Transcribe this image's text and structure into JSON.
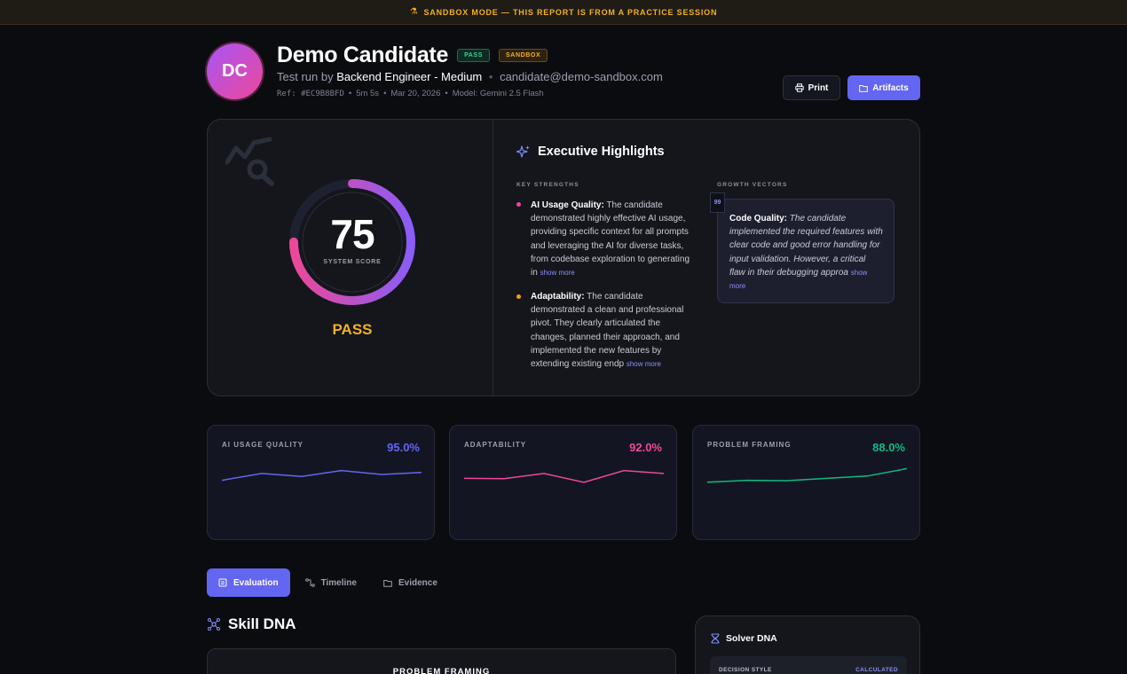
{
  "banner": {
    "icon": "flask-icon",
    "text": "SANDBOX MODE — THIS REPORT IS FROM A PRACTICE SESSION"
  },
  "candidate": {
    "initials": "DC",
    "name": "Demo Candidate",
    "badges": {
      "pass": "PASS",
      "sandbox": "SANDBOX"
    },
    "test_prefix": "Test run by",
    "role": "Backend Engineer - Medium",
    "email": "candidate@demo-sandbox.com",
    "ref": "Ref: #EC9B8BFD",
    "duration": "5m 5s",
    "date": "Mar 20, 2026",
    "model": "Model: Gemini 2.5 Flash"
  },
  "actions": {
    "print": "Print",
    "artifacts": "Artifacts"
  },
  "score": {
    "value": "75",
    "value_fraction": 0.75,
    "label": "SYSTEM SCORE",
    "verdict": "PASS"
  },
  "highlights": {
    "title": "Executive Highlights",
    "strengths_label": "KEY STRENGTHS",
    "growth_label": "GROWTH VECTORS",
    "show_more": "show more",
    "strengths": [
      {
        "title": "AI Usage Quality:",
        "text": "The candidate demonstrated highly effective AI usage, providing specific context for all prompts and leveraging the AI for diverse tasks, from codebase exploration to generating in",
        "color": "#ec4899"
      },
      {
        "title": "Adaptability:",
        "text": "The candidate demonstrated a clean and professional pivot. They clearly articulated the changes, planned their approach, and implemented the new features by extending existing endp",
        "color": "#f59e0b"
      }
    ],
    "growth": {
      "quote_mark": "99",
      "title": "Code Quality:",
      "text": "The candidate implemented the required features with clear code and good error handling for input validation. However, a critical flaw in their debugging approa"
    }
  },
  "metrics": [
    {
      "label": "AI USAGE QUALITY",
      "value": "95.0%",
      "color": "#6366f1",
      "trend": [
        0.2,
        0.55,
        0.4,
        0.7,
        0.5,
        0.6
      ]
    },
    {
      "label": "ADAPTABILITY",
      "value": "92.0%",
      "color": "#ec4899",
      "trend": [
        0.3,
        0.28,
        0.55,
        0.1,
        0.7,
        0.55
      ]
    },
    {
      "label": "PROBLEM FRAMING",
      "value": "88.0%",
      "color": "#10b981",
      "trend": [
        0.1,
        0.2,
        0.18,
        0.3,
        0.42,
        0.8
      ]
    }
  ],
  "tabs": [
    {
      "label": "Evaluation",
      "icon": "clipboard-icon",
      "active": true
    },
    {
      "label": "Timeline",
      "icon": "timeline-icon",
      "active": false
    },
    {
      "label": "Evidence",
      "icon": "folder-icon",
      "active": false
    }
  ],
  "skill": {
    "title": "Skill DNA",
    "card_title": "PROBLEM FRAMING"
  },
  "solver": {
    "title": "Solver DNA",
    "row_label": "DECISION STYLE",
    "row_value": "CALCULATED"
  },
  "colors": {
    "accent": "#6366f1",
    "pass": "#f2b024",
    "sandbox": "#f2b024",
    "background": "#0b0c10"
  }
}
